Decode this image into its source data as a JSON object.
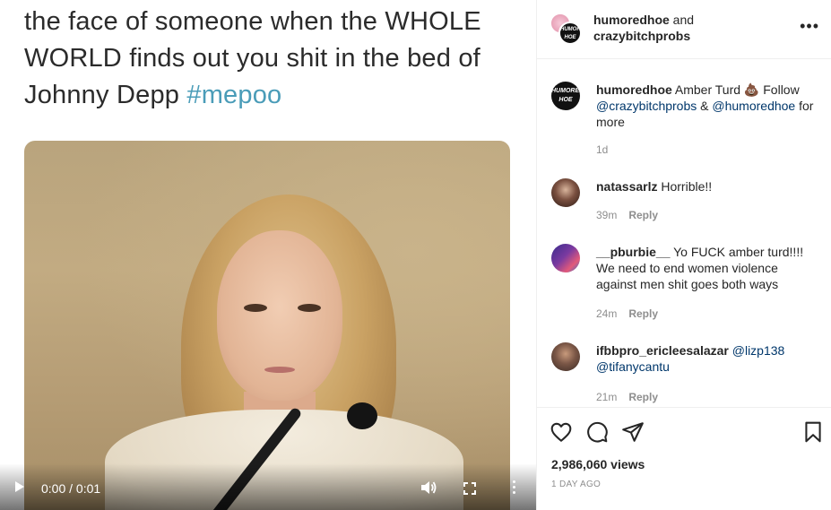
{
  "media": {
    "caption_main": "the face of someone when the WHOLE WORLD finds out you shit in the bed of Johnny Depp ",
    "caption_tag": "#mepoo",
    "time_display": "0:00 / 0:01"
  },
  "header": {
    "user1": "humoredhoe",
    "joiner": " and",
    "user2": "crazybitchprobs",
    "more": "•••"
  },
  "comments": [
    {
      "user": "humoredhoe",
      "text_parts": [
        " Amber Turd 💩 Follow ",
        "@crazybitchprobs",
        " & ",
        "@humoredhoe",
        " for more"
      ],
      "time": "1d",
      "reply": ""
    },
    {
      "user": "natassarlz",
      "text": " Horrible!!",
      "time": "39m",
      "reply": "Reply"
    },
    {
      "user": "__pburbie__",
      "text": " Yo FUCK amber turd!!!! We need to end women violence against men shit goes both ways",
      "time": "24m",
      "reply": "Reply"
    },
    {
      "user": "ifbbpro_ericleesalazar",
      "mention1": " @lizp138",
      "mention2": "@tifanycantu",
      "time": "21m",
      "reply": "Reply"
    }
  ],
  "stats": {
    "views": "2,986,060 views",
    "date": "1 DAY AGO"
  },
  "logo_text": "HUMORED HOE",
  "icons": [
    "play-icon",
    "volume-icon",
    "fullscreen-icon",
    "more-vertical-icon",
    "heart-icon",
    "comment-icon",
    "share-icon",
    "bookmark-icon"
  ]
}
